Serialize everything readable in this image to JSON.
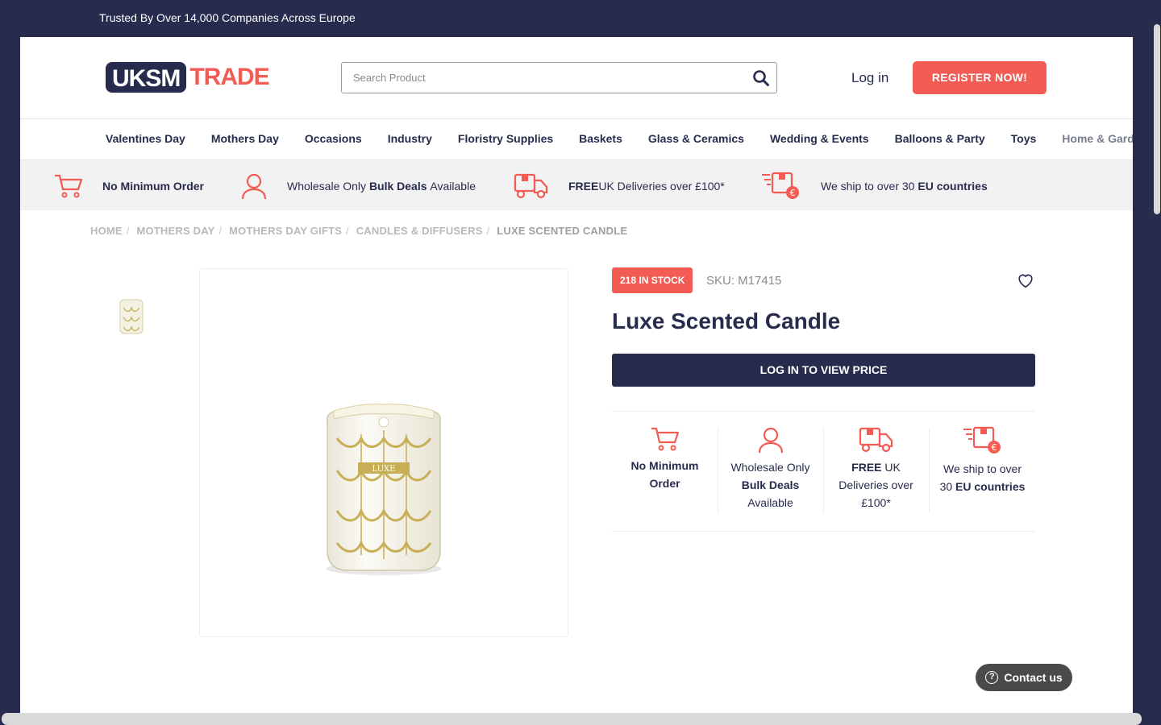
{
  "topbar": {
    "trust_text": "Trusted By Over 14,000 Companies Across Europe"
  },
  "header": {
    "logo_left": "UKSM",
    "logo_right": "TRADE",
    "search_placeholder": "Search Product",
    "login_label": "Log in",
    "register_label": "REGISTER NOW!"
  },
  "nav": {
    "items": [
      "Valentines Day",
      "Mothers Day",
      "Occasions",
      "Industry",
      "Floristry Supplies",
      "Baskets",
      "Glass & Ceramics",
      "Wedding & Events",
      "Balloons & Party",
      "Toys",
      "Home & Garden"
    ]
  },
  "benefits": {
    "b1": {
      "bold": "No Minimum Order",
      "icon": "cart-icon"
    },
    "b2": {
      "pre": "Wholesale Only ",
      "bold": "Bulk Deals",
      "post": " Available",
      "icon": "user-icon"
    },
    "b3": {
      "bold": "FREE",
      "post": " UK Deliveries over £100*",
      "icon": "truck-icon"
    },
    "b4": {
      "pre": "We ship to over 30 ",
      "bold": "EU countries",
      "icon": "shipping-euro-icon"
    }
  },
  "breadcrumb": [
    "HOME",
    "MOTHERS DAY",
    "MOTHERS DAY GIFTS",
    "CANDLES & DIFFUSERS",
    "LUXE SCENTED CANDLE"
  ],
  "product": {
    "stock_badge": "218 IN STOCK",
    "sku": "SKU: M17415",
    "title": "Luxe Scented Candle",
    "view_price_label": "LOG IN TO VIEW PRICE",
    "candle_label": "LUXE"
  },
  "features": {
    "f1": {
      "line1": "No Minimum",
      "line2": "Order"
    },
    "f2": {
      "line1": "Wholesale Only",
      "line2": "Bulk Deals",
      "line3": "Available"
    },
    "f3": {
      "line1a": "FREE",
      "line1b": " UK",
      "line2": "Deliveries over",
      "line3": "£100*"
    },
    "f4": {
      "line1": "We ship to over",
      "line2a": "30 ",
      "line2b": "EU countries"
    }
  },
  "contact": {
    "label": "Contact us",
    "icon_glyph": "?"
  },
  "colors": {
    "navy": "#272b4d",
    "accent": "#f25c54",
    "background": "#f2f2f2"
  }
}
